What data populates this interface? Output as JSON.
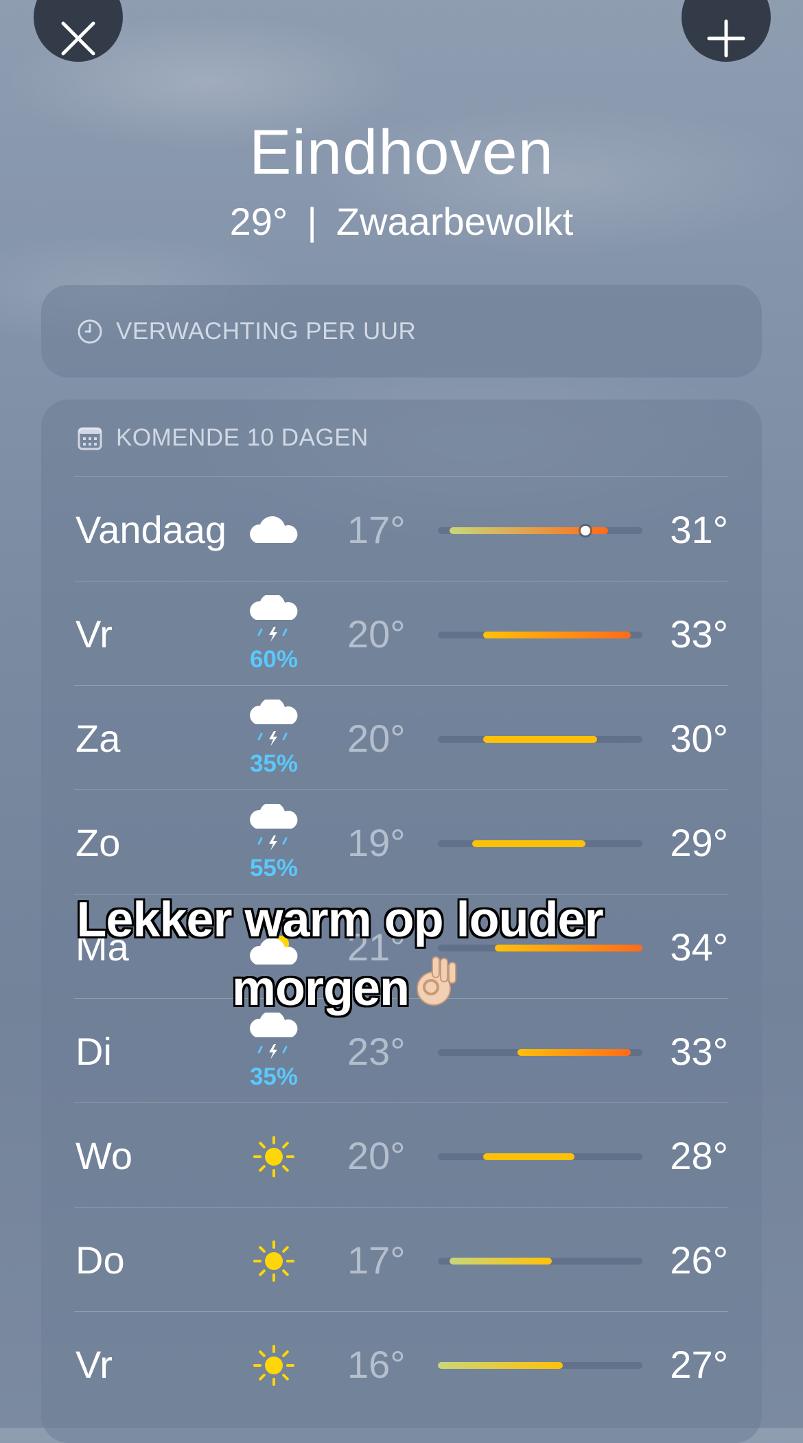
{
  "header": {
    "city": "Eindhoven",
    "current_temp": "29°",
    "separator": "|",
    "condition": "Zwaarbewolkt"
  },
  "buttons": {
    "close_icon": "xmark-icon",
    "add_icon": "plus-icon"
  },
  "hourly": {
    "label": "VERWACHTING PER UUR",
    "icon": "clock-icon"
  },
  "daily": {
    "label": "KOMENDE 10 DAGEN",
    "icon": "calendar-icon",
    "range_scale": {
      "min": 16,
      "max": 34
    },
    "days": [
      {
        "name": "Vandaag",
        "icon": "cloud-icon",
        "precip": "",
        "low": "17°",
        "high": "31°",
        "low_value": 17,
        "high_value": 31,
        "current_value": 29
      },
      {
        "name": "Vr",
        "icon": "cloud-bolt-rain-icon",
        "precip": "60%",
        "low": "20°",
        "high": "33°",
        "low_value": 20,
        "high_value": 33
      },
      {
        "name": "Za",
        "icon": "cloud-bolt-rain-icon",
        "precip": "35%",
        "low": "20°",
        "high": "30°",
        "low_value": 20,
        "high_value": 30
      },
      {
        "name": "Zo",
        "icon": "cloud-bolt-rain-icon",
        "precip": "55%",
        "low": "19°",
        "high": "29°",
        "low_value": 19,
        "high_value": 29
      },
      {
        "name": "Ma",
        "icon": "cloud-sun-icon",
        "precip": "",
        "low": "21°",
        "high": "34°",
        "low_value": 21,
        "high_value": 34
      },
      {
        "name": "Di",
        "icon": "cloud-bolt-rain-icon",
        "precip": "35%",
        "low": "23°",
        "high": "33°",
        "low_value": 23,
        "high_value": 33
      },
      {
        "name": "Wo",
        "icon": "sun-icon",
        "precip": "",
        "low": "20°",
        "high": "28°",
        "low_value": 20,
        "high_value": 28
      },
      {
        "name": "Do",
        "icon": "sun-icon",
        "precip": "",
        "low": "17°",
        "high": "26°",
        "low_value": 17,
        "high_value": 26
      },
      {
        "name": "Vr",
        "icon": "sun-icon",
        "precip": "",
        "low": "16°",
        "high": "27°",
        "low_value": 16,
        "high_value": 27
      }
    ]
  },
  "overlay": {
    "caption_line1": "Lekker warm op louder",
    "caption_line2": "morgen",
    "emoji_icon": "ok-hand-emoji-icon"
  },
  "colors": {
    "precip": "#5ac8fa",
    "sun": "#ffd60a",
    "cool": "#c9d67a",
    "warm": "#ffc107",
    "hot": "#ff6b1a"
  }
}
